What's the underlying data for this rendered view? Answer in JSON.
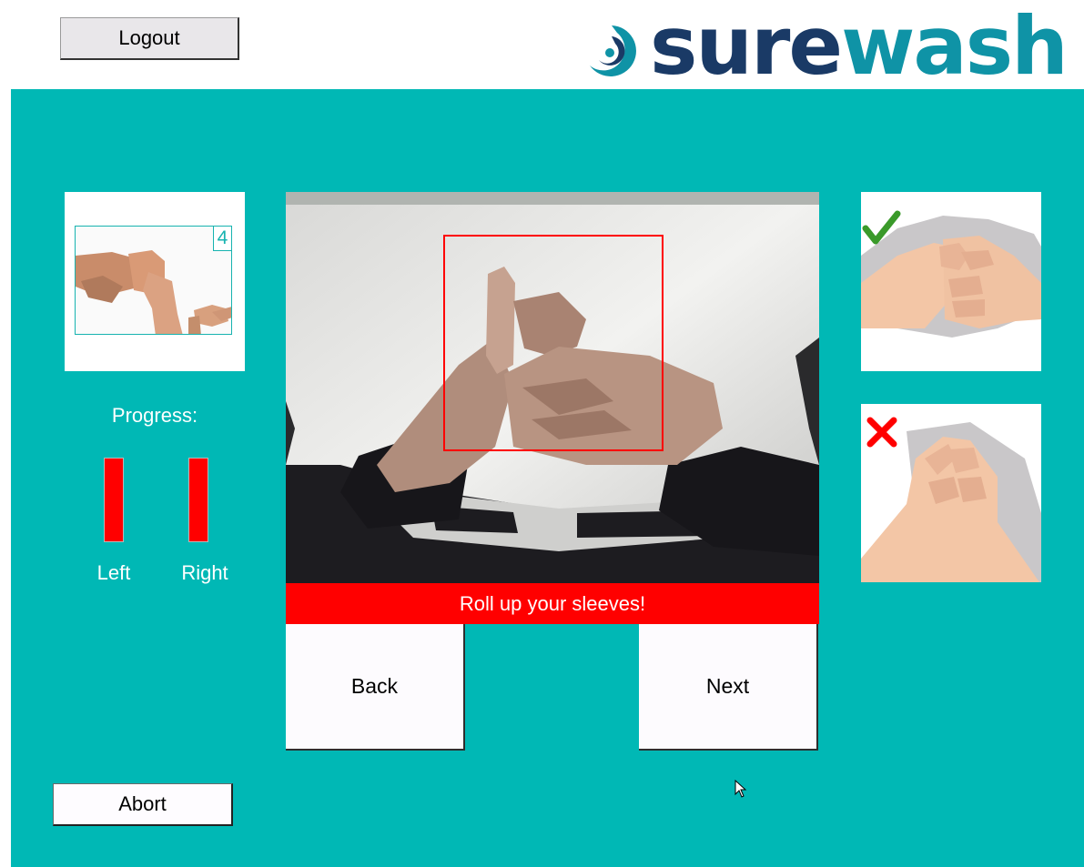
{
  "header": {
    "logout_label": "Logout",
    "logo": {
      "text_part1": "sure",
      "text_part2": "wash",
      "colors": {
        "dark": "#1a3a66",
        "teal": "#0f93a6"
      }
    }
  },
  "sidebar": {
    "step_number": "4",
    "progress_label": "Progress:",
    "progress": {
      "left_label": "Left",
      "right_label": "Right",
      "left_fraction": 0.0,
      "right_fraction": 0.0,
      "bar_color": "#ff0000"
    },
    "abort_label": "Abort"
  },
  "camera": {
    "status_message": "Roll up your sleeves!",
    "status_color": "#ff0000",
    "detection_box_color": "#ff0000"
  },
  "navigation": {
    "back_label": "Back",
    "next_label": "Next"
  },
  "examples": {
    "correct_icon": "check-icon",
    "incorrect_icon": "cross-icon",
    "correct_color": "#3a9a2a",
    "incorrect_color": "#ff0000"
  },
  "theme": {
    "background": "#00b8b5",
    "header_background": "#ffffff"
  }
}
